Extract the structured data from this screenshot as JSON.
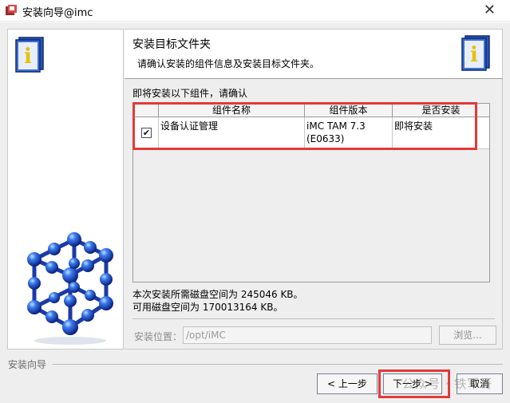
{
  "window": {
    "title": "安装向导@imc",
    "close_glyph": "✕"
  },
  "header": {
    "title": "安装目标文件夹",
    "subtitle": "请确认安装的组件信息及安装目标文件夹。"
  },
  "content": {
    "confirm_text": "即将安装以下组件，请确认",
    "table": {
      "columns": [
        "组件名称",
        "组件版本",
        "是否安装"
      ],
      "rows": [
        {
          "checked": true,
          "check_glyph": "✔",
          "name": "设备认证管理",
          "version_line1": "iMC TAM 7.3",
          "version_line2": "(E0633)",
          "install": "即将安装"
        }
      ]
    },
    "disk_required": "本次安装所需磁盘空间为 245046 KB。",
    "disk_available": "可用磁盘空间为 170013164 KB。",
    "location_label": "安装位置：",
    "location_value": "/opt/iMC",
    "browse_label": "浏览..."
  },
  "footer": {
    "label": "安装向导",
    "prev_label": "< 上一步",
    "next_label": "下一步 >",
    "cancel_label": "取消",
    "watermark": "公众号 · 铁军哥"
  },
  "colors": {
    "highlight": "#e23a3a",
    "panel_bg": "#eeeeee"
  }
}
